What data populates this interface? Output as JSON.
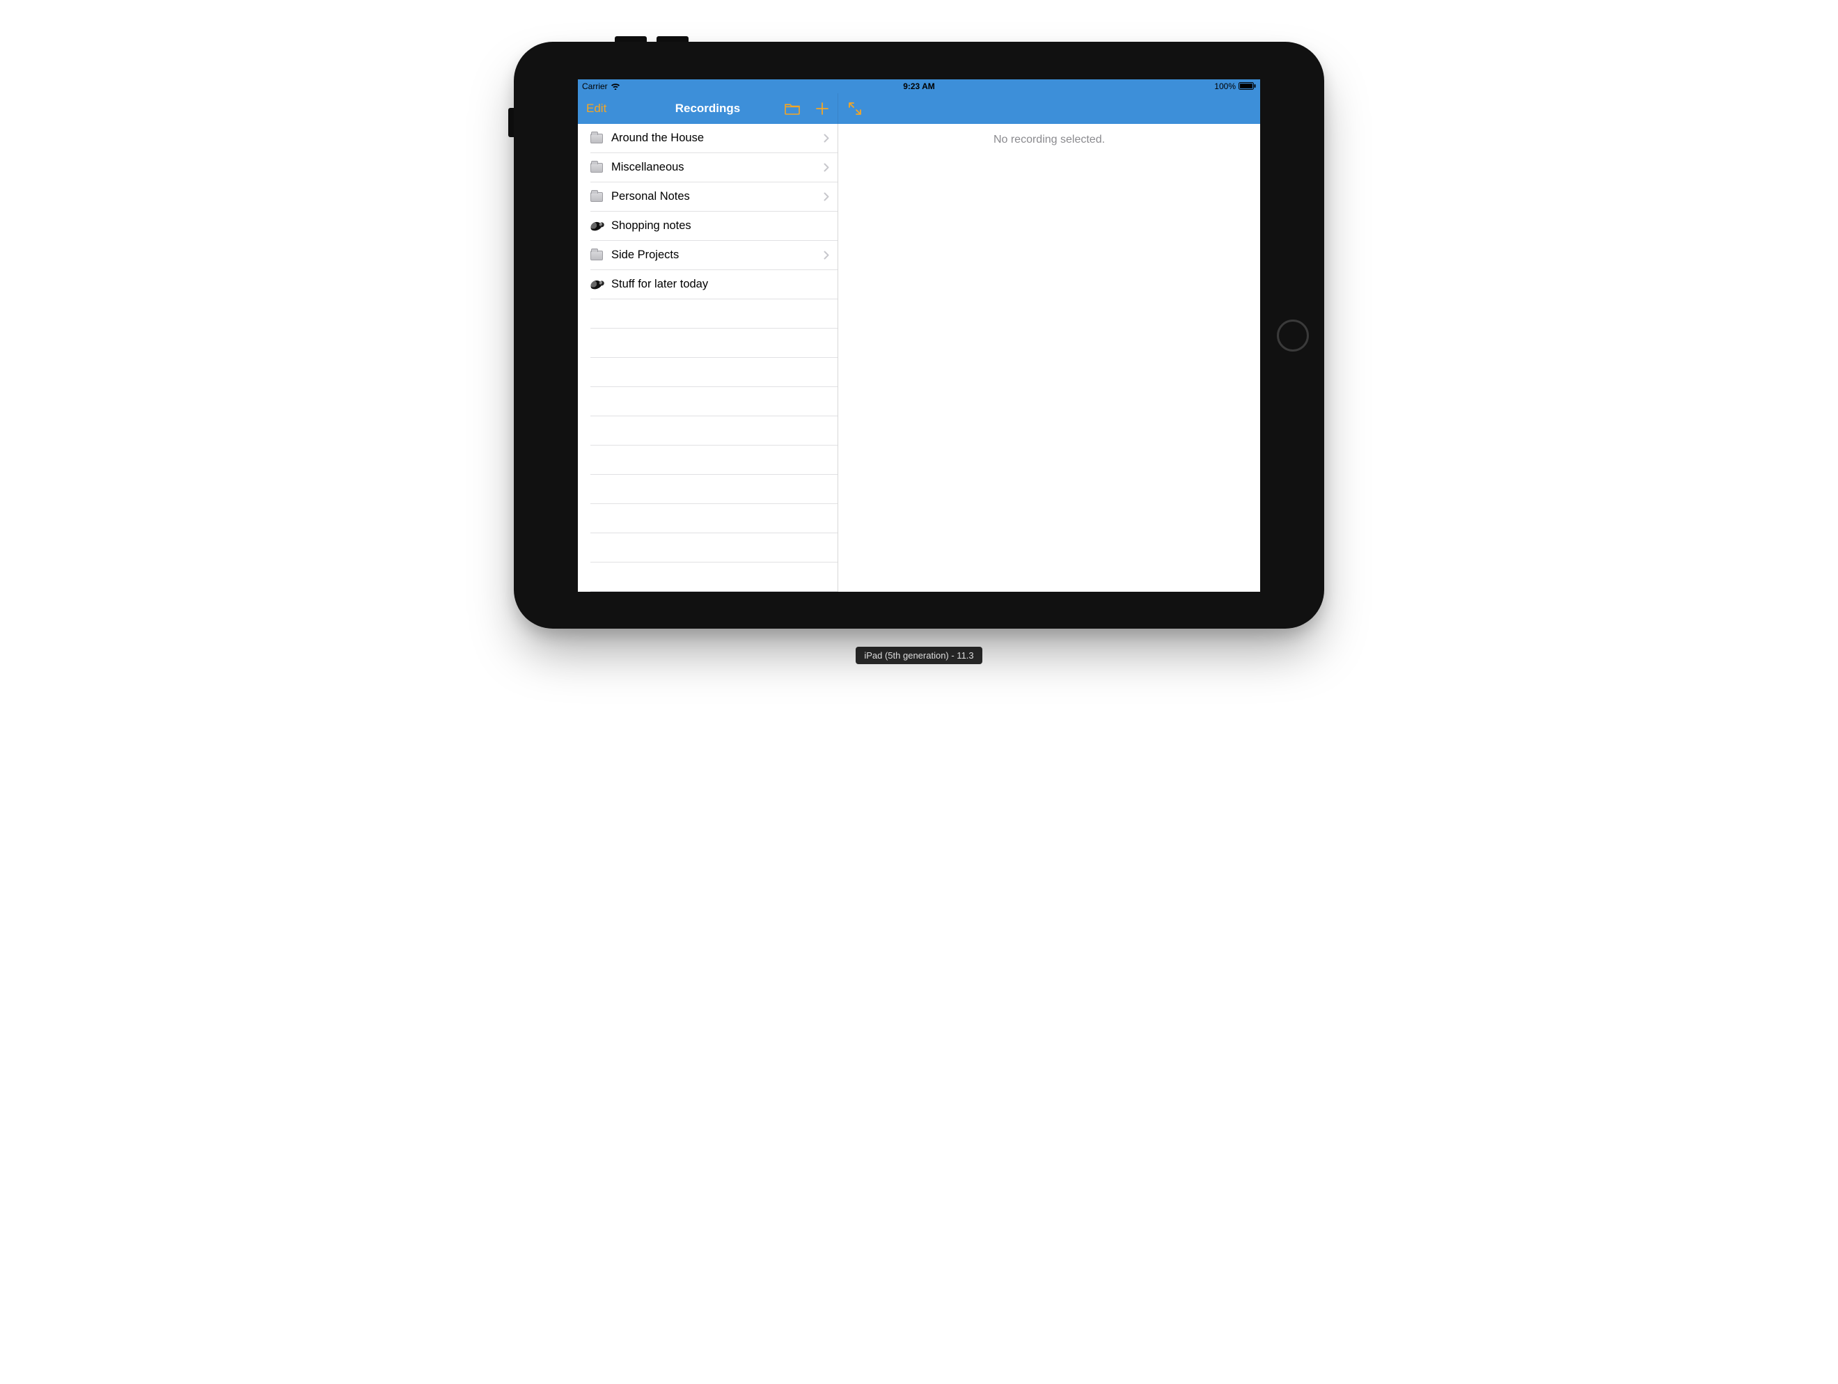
{
  "status": {
    "carrier": "Carrier",
    "time": "9:23 AM",
    "battery": "100%"
  },
  "nav": {
    "edit": "Edit",
    "title": "Recordings"
  },
  "detail": {
    "empty": "No recording selected."
  },
  "rows": [
    {
      "label": "Around the House",
      "type": "folder",
      "disclosure": true
    },
    {
      "label": "Miscellaneous",
      "type": "folder",
      "disclosure": true
    },
    {
      "label": "Personal Notes",
      "type": "folder",
      "disclosure": true
    },
    {
      "label": "Shopping notes",
      "type": "recording",
      "disclosure": false
    },
    {
      "label": "Side Projects",
      "type": "folder",
      "disclosure": true
    },
    {
      "label": "Stuff for later today",
      "type": "recording",
      "disclosure": false
    }
  ],
  "simulator": {
    "caption": "iPad (5th generation) - 11.3"
  },
  "colors": {
    "navbar": "#3d8fd9",
    "accent": "#f5a623"
  }
}
